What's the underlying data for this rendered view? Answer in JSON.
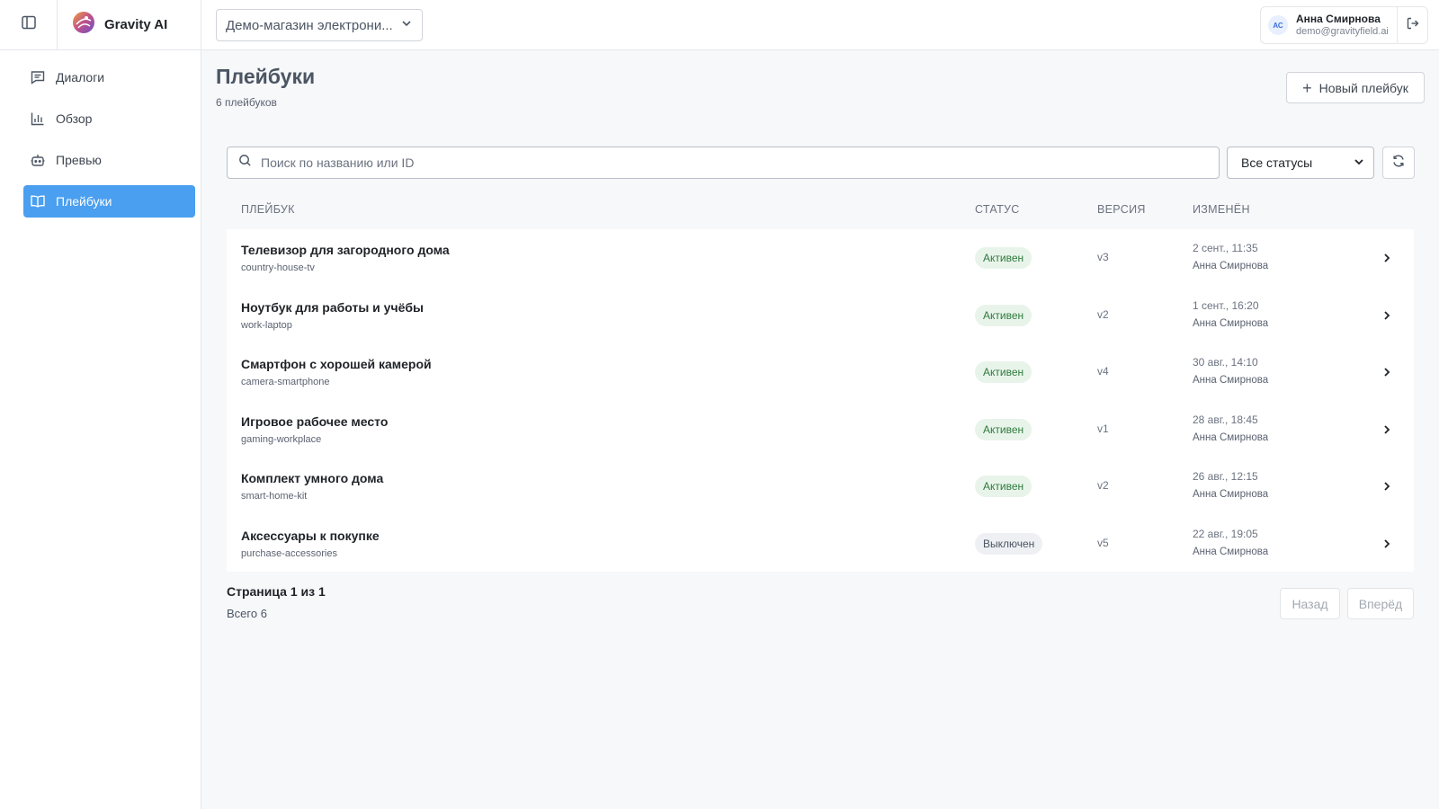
{
  "app": {
    "name": "Gravity AI"
  },
  "store_select": {
    "value": "Демо-магазин электрони..."
  },
  "user": {
    "initials": "АС",
    "name": "Анна Смирнова",
    "email": "demo@gravityfield.ai"
  },
  "sidebar": {
    "items": [
      {
        "label": "Диалоги",
        "icon": "chat-icon"
      },
      {
        "label": "Обзор",
        "icon": "bar-chart-icon"
      },
      {
        "label": "Превью",
        "icon": "bot-icon"
      },
      {
        "label": "Плейбуки",
        "icon": "book-icon",
        "active": true
      }
    ]
  },
  "page": {
    "title": "Плейбуки",
    "subtitle": "6 плейбуков",
    "new_button": "Новый плейбук"
  },
  "search": {
    "placeholder": "Поиск по названию или ID",
    "value": ""
  },
  "status_filter": {
    "value": "Все статусы"
  },
  "table": {
    "headers": {
      "name": "ПЛЕЙБУК",
      "status": "СТАТУС",
      "version": "ВЕРСИЯ",
      "modified": "ИЗМЕНЁН"
    },
    "rows": [
      {
        "name": "Телевизор для загородного дома",
        "slug": "country-house-tv",
        "status": "Активен",
        "status_kind": "active",
        "version": "v3",
        "date": "2 сент., 11:35",
        "author": "Анна Смирнова"
      },
      {
        "name": "Ноутбук для работы и учёбы",
        "slug": "work-laptop",
        "status": "Активен",
        "status_kind": "active",
        "version": "v2",
        "date": "1 сент., 16:20",
        "author": "Анна Смирнова"
      },
      {
        "name": "Смартфон с хорошей камерой",
        "slug": "camera-smartphone",
        "status": "Активен",
        "status_kind": "active",
        "version": "v4",
        "date": "30 авг., 14:10",
        "author": "Анна Смирнова"
      },
      {
        "name": "Игровое рабочее место",
        "slug": "gaming-workplace",
        "status": "Активен",
        "status_kind": "active",
        "version": "v1",
        "date": "28 авг., 18:45",
        "author": "Анна Смирнова"
      },
      {
        "name": "Комплект умного дома",
        "slug": "smart-home-kit",
        "status": "Активен",
        "status_kind": "active",
        "version": "v2",
        "date": "26 авг., 12:15",
        "author": "Анна Смирнова"
      },
      {
        "name": "Аксессуары к покупке",
        "slug": "purchase-accessories",
        "status": "Выключен",
        "status_kind": "off",
        "version": "v5",
        "date": "22 авг., 19:05",
        "author": "Анна Смирнова"
      }
    ]
  },
  "pagination": {
    "title": "Страница 1 из 1",
    "total": "Всего 6",
    "prev": "Назад",
    "next": "Вперёд"
  },
  "colors": {
    "accent": "#4a9ff0",
    "badge_active_bg": "#e8f4ea",
    "badge_active_text": "#2f7a3d",
    "badge_off_bg": "#eef0f3"
  }
}
